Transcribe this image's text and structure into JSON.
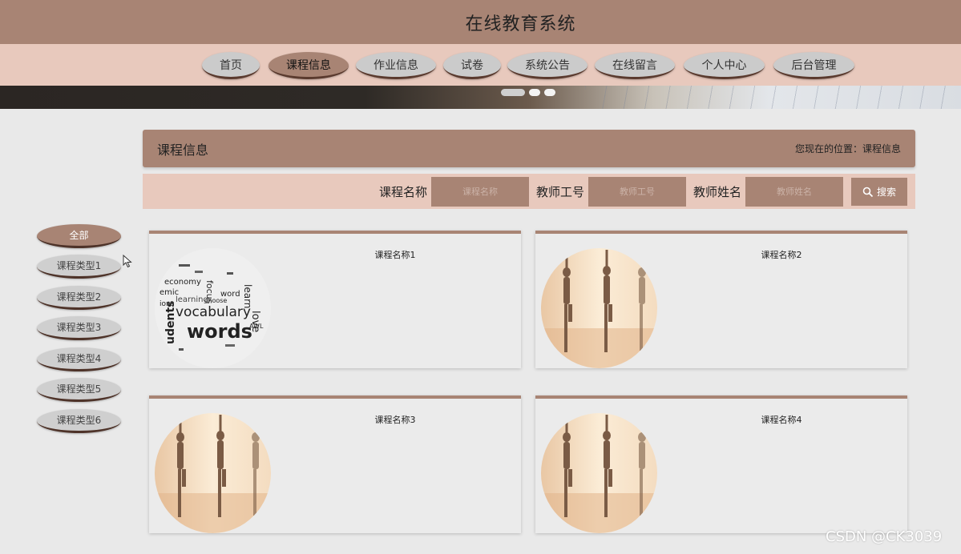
{
  "header": {
    "title": "在线教育系统"
  },
  "nav": {
    "items": [
      {
        "label": "首页"
      },
      {
        "label": "课程信息"
      },
      {
        "label": "作业信息"
      },
      {
        "label": "试卷"
      },
      {
        "label": "系统公告"
      },
      {
        "label": "在线留言"
      },
      {
        "label": "个人中心"
      },
      {
        "label": "后台管理"
      }
    ],
    "active_index": 1
  },
  "section": {
    "title": "课程信息",
    "breadcrumb": "您现在的位置：课程信息"
  },
  "search": {
    "fields": [
      {
        "label": "课程名称",
        "placeholder": "课程名称"
      },
      {
        "label": "教师工号",
        "placeholder": "教师工号"
      },
      {
        "label": "教师姓名",
        "placeholder": "教师姓名"
      }
    ],
    "button_label": "搜索"
  },
  "sidebar": {
    "categories": [
      {
        "label": "全部"
      },
      {
        "label": "课程类型1"
      },
      {
        "label": "课程类型2"
      },
      {
        "label": "课程类型3"
      },
      {
        "label": "课程类型4"
      },
      {
        "label": "课程类型5"
      },
      {
        "label": "课程类型6"
      }
    ]
  },
  "courses": [
    {
      "name": "课程名称1",
      "image": "vocabulary-word-cloud"
    },
    {
      "name": "课程名称2",
      "image": "yoga-studio"
    },
    {
      "name": "课程名称3",
      "image": "yoga-studio"
    },
    {
      "name": "课程名称4",
      "image": "yoga-studio"
    }
  ],
  "vocab_words": [
    "vocabulary",
    "words",
    "learning",
    "love",
    "learn",
    "economy",
    "focus",
    "word",
    "choose",
    "AWL",
    "udents",
    "emic",
    "ions"
  ],
  "watermark": "CSDN @CK3039",
  "colors": {
    "brand": "#a88474",
    "nav_bg": "#e8c9bd",
    "page_bg": "#e9e9e9"
  }
}
